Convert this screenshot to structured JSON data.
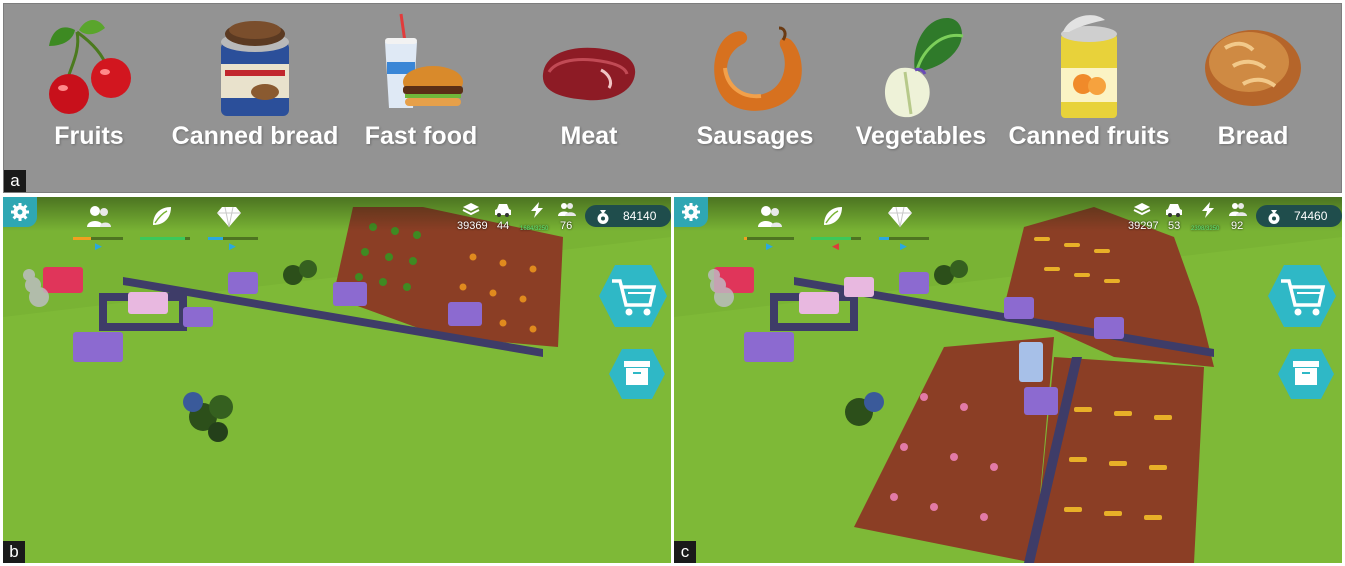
{
  "panel_a": {
    "tag": "a",
    "foods": [
      {
        "label": "Fruits",
        "icon": "cherries-icon"
      },
      {
        "label": "Canned bread",
        "icon": "canned-bread-icon"
      },
      {
        "label": "Fast food",
        "icon": "burger-and-drink-icon"
      },
      {
        "label": "Meat",
        "icon": "raw-meat-icon"
      },
      {
        "label": "Sausages",
        "icon": "sausage-ring-icon"
      },
      {
        "label": "Vegetables",
        "icon": "bok-choy-icon"
      },
      {
        "label": "Canned fruits",
        "icon": "canned-fruit-icon"
      },
      {
        "label": "Bread",
        "icon": "bread-loaf-icon"
      }
    ]
  },
  "panel_b": {
    "tag": "b",
    "stats": {
      "layers": "39369",
      "cars": "44",
      "energy": "1684/3250",
      "population": "76"
    },
    "money": "84140",
    "progress": {
      "people": 0.35,
      "nature": 0.9,
      "gems": 0.3
    }
  },
  "panel_c": {
    "tag": "c",
    "stats": {
      "layers": "39297",
      "cars": "53",
      "energy": "2398/3250",
      "population": "92"
    },
    "money": "74460",
    "progress": {
      "people": 0.05,
      "nature": 0.8,
      "gems": 0.2
    }
  },
  "colors": {
    "grass": "#79b334",
    "teal_button": "#2fa7b3",
    "money_pill": "#1f4d4c",
    "farmland": "#8b3e25",
    "road": "#3e3c68",
    "buildings": "#8c6ad0",
    "progress_orange": "#f0a020",
    "progress_green": "#3cc85a",
    "progress_blue": "#2aa8e0",
    "progress_red": "#e03a3a"
  },
  "icons": {
    "settings": "gear-icon",
    "people": "people-icon",
    "nature": "leaf-icon",
    "gems": "diamond-icon",
    "layers": "layers-icon",
    "cars": "car-icon",
    "energy": "lightning-icon",
    "population": "population-icon",
    "money": "money-bag-icon",
    "shop": "shopping-cart-icon",
    "storage": "storage-box-icon"
  }
}
